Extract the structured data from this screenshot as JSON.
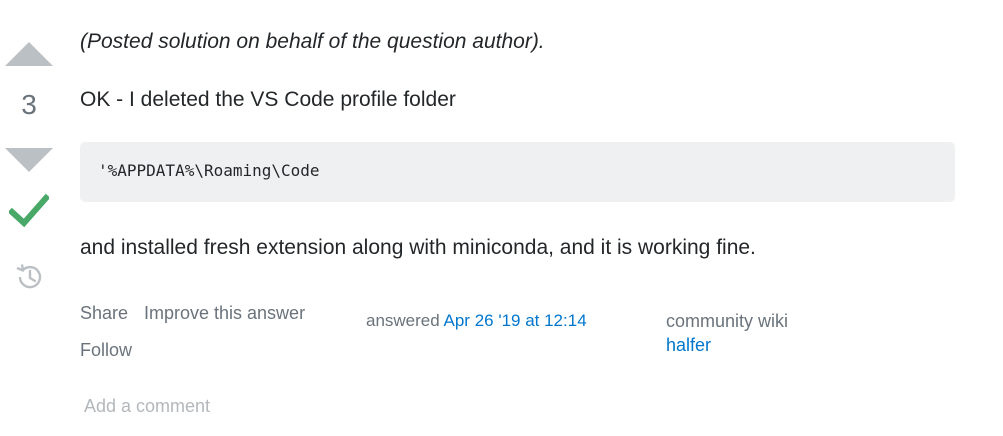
{
  "votes": {
    "count": "3",
    "up_icon": "arrow-up-icon",
    "down_icon": "arrow-down-icon",
    "accepted_icon": "checkmark-icon",
    "history_icon": "history-icon",
    "accepted_color": "#48a868",
    "arrow_color": "#bbc0c4"
  },
  "post": {
    "note": "(Posted solution on behalf of the question author).",
    "line1": "OK - I deleted the VS Code profile folder",
    "code": "'%APPDATA%\\Roaming\\Code",
    "line2": "and installed fresh extension along with miniconda, and it is working fine."
  },
  "menu": {
    "share": "Share",
    "improve": "Improve this answer",
    "follow": "Follow"
  },
  "signature": {
    "answered_prefix": "answered",
    "answered_date": "Apr 26 '19 at 12:14",
    "community_label": "community wiki",
    "user": "halfer",
    "link_color": "#0077cc"
  },
  "comments": {
    "add_label": "Add a comment"
  }
}
